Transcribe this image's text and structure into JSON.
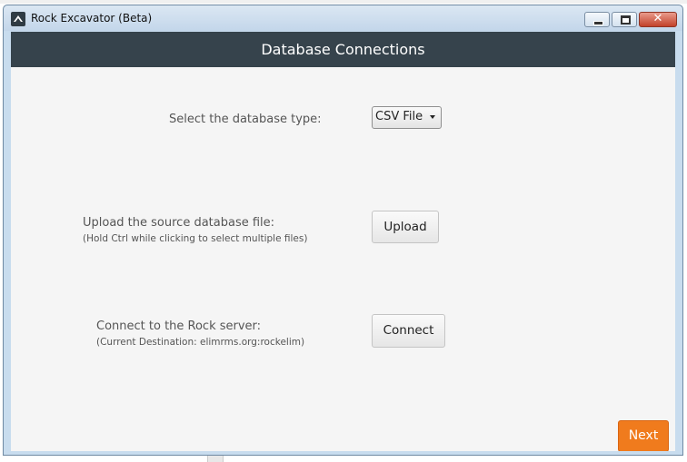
{
  "window": {
    "title": "Rock Excavator (Beta)",
    "close_symbol": "✕"
  },
  "header": {
    "title": "Database Connections"
  },
  "db_type": {
    "label": "Select the database type:",
    "selected": "CSV File"
  },
  "upload": {
    "label": "Upload the source database file:",
    "hint": "(Hold Ctrl while clicking to select multiple files)",
    "button_label": "Upload"
  },
  "connect": {
    "label": "Connect to the Rock server:",
    "hint": "(Current Destination: elimrms.org:rockelim)",
    "button_label": "Connect"
  },
  "footer": {
    "next_label": "Next"
  },
  "colors": {
    "header_bg": "#36434c",
    "accent": "#f07b1d",
    "panel_bg": "#f5f5f5"
  }
}
